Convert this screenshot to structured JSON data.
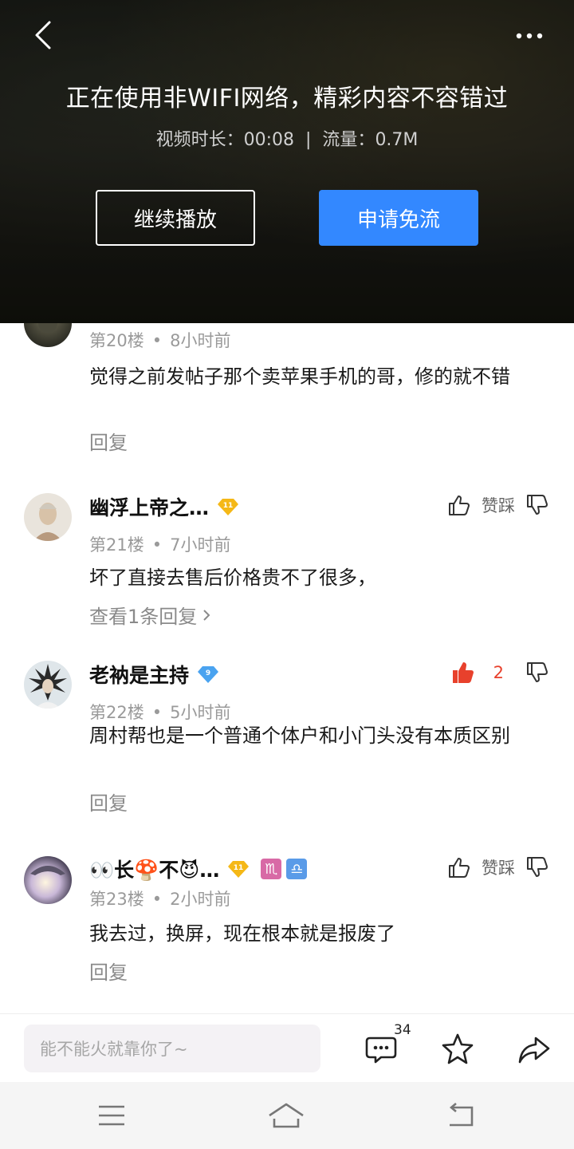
{
  "video": {
    "title": "正在使用非WIFI网络，精彩内容不容错过",
    "duration_label": "视频时长：",
    "duration": "00:08",
    "separator": "|",
    "traffic_label": "流量：",
    "traffic": "0.7M",
    "continue_button": "继续播放",
    "free_button": "申请免流"
  },
  "comments": [
    {
      "username": "",
      "floor": "第20楼",
      "time": "8小时前",
      "text": "觉得之前发帖子那个卖苹果手机的哥，修的就不错",
      "reply": "回复"
    },
    {
      "username": "幽浮上帝之…",
      "level": "11",
      "floor": "第21楼",
      "time": "7小时前",
      "text": "坏了直接去售后价格贵不了很多，",
      "reply": "查看1条回复",
      "action_label": "赞踩"
    },
    {
      "username": "老衲是主持",
      "level": "9",
      "floor": "第22楼",
      "time": "5小时前",
      "text": "周村帮也是一个普通个体户和小门头没有本质区别",
      "reply": "回复",
      "like_count": "2"
    },
    {
      "username": "👀长🍄不😈…",
      "level": "11",
      "zodiac": [
        "♏",
        "♎"
      ],
      "floor": "第23楼",
      "time": "2小时前",
      "text": "我去过，换屏，现在根本就是报废了",
      "reply": "回复",
      "action_label": "赞踩"
    }
  ],
  "bottom_bar": {
    "input_placeholder": "能不能火就靠你了~",
    "comment_count": "34"
  },
  "colors": {
    "accent": "#3388ff",
    "like_red": "#e8412c",
    "level_gold": "#f5b817",
    "level_blue": "#4aa3f0"
  }
}
